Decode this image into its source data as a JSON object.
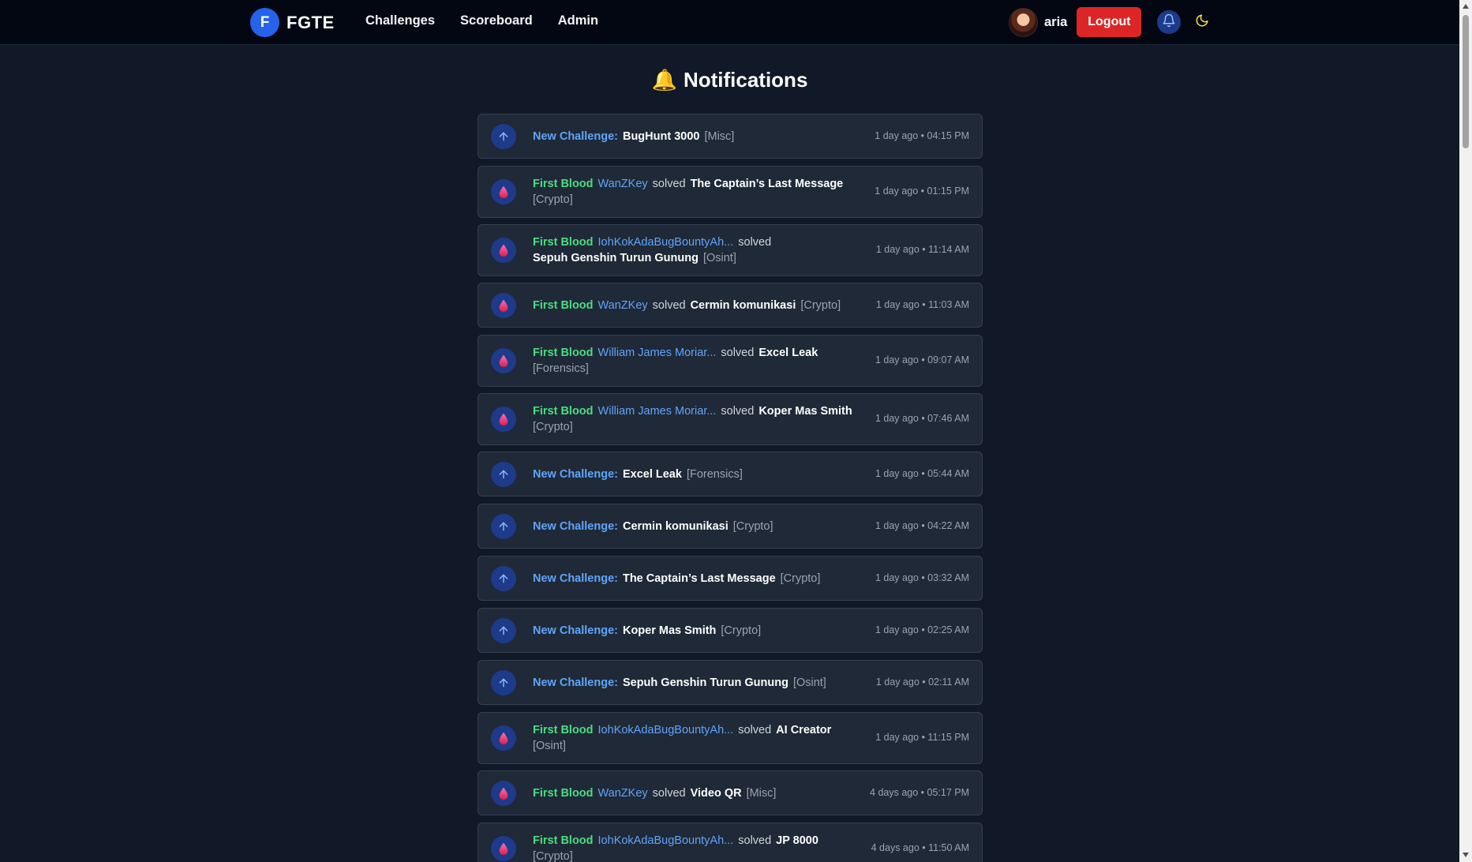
{
  "brand": {
    "logo_letter": "F",
    "name": "FGTE"
  },
  "nav": {
    "items": [
      "Challenges",
      "Scoreboard",
      "Admin"
    ]
  },
  "user": {
    "name": "aria",
    "logout_label": "Logout"
  },
  "colors": {
    "background": "#111827",
    "navbar": "#030712",
    "card": "#1f2937",
    "accent_blue": "#60a5fa",
    "first_blood_green": "#4ade80",
    "logout_red": "#dc2626"
  },
  "icons": {
    "bell": "bell-icon",
    "moon": "moon-icon",
    "new_challenge": "arrow-up-icon",
    "first_blood": "blood-drop-icon"
  },
  "page": {
    "title_icon": "🔔",
    "title": "Notifications"
  },
  "notifications": [
    {
      "type": "new",
      "label": "New Challenge:",
      "challenge": "BugHunt 3000",
      "category": "[Misc]",
      "time": "1 day ago • 04:15 PM"
    },
    {
      "type": "blood",
      "label": "First Blood",
      "user": "WanZKey",
      "verb": "solved",
      "challenge": "The Captain’s Last Message",
      "category": "[Crypto]",
      "time": "1 day ago • 01:15 PM"
    },
    {
      "type": "blood",
      "label": "First Blood",
      "user": "IohKokAdaBugBountyAh...",
      "verb": "solved",
      "challenge": "Sepuh Genshin Turun Gunung",
      "category": "[Osint]",
      "time": "1 day ago • 11:14 AM"
    },
    {
      "type": "blood",
      "label": "First Blood",
      "user": "WanZKey",
      "verb": "solved",
      "challenge": "Cermin komunikasi",
      "category": "[Crypto]",
      "time": "1 day ago • 11:03 AM"
    },
    {
      "type": "blood",
      "label": "First Blood",
      "user": "William James Moriar...",
      "verb": "solved",
      "challenge": "Excel Leak",
      "category": "[Forensics]",
      "time": "1 day ago • 09:07 AM"
    },
    {
      "type": "blood",
      "label": "First Blood",
      "user": "William James Moriar...",
      "verb": "solved",
      "challenge": "Koper Mas Smith",
      "category": "[Crypto]",
      "time": "1 day ago • 07:46 AM"
    },
    {
      "type": "new",
      "label": "New Challenge:",
      "challenge": "Excel Leak",
      "category": "[Forensics]",
      "time": "1 day ago • 05:44 AM"
    },
    {
      "type": "new",
      "label": "New Challenge:",
      "challenge": "Cermin komunikasi",
      "category": "[Crypto]",
      "time": "1 day ago • 04:22 AM"
    },
    {
      "type": "new",
      "label": "New Challenge:",
      "challenge": "The Captain’s Last Message",
      "category": "[Crypto]",
      "time": "1 day ago • 03:32 AM"
    },
    {
      "type": "new",
      "label": "New Challenge:",
      "challenge": "Koper Mas Smith",
      "category": "[Crypto]",
      "time": "1 day ago • 02:25 AM"
    },
    {
      "type": "new",
      "label": "New Challenge:",
      "challenge": "Sepuh Genshin Turun Gunung",
      "category": "[Osint]",
      "time": "1 day ago • 02:11 AM"
    },
    {
      "type": "blood",
      "label": "First Blood",
      "user": "IohKokAdaBugBountyAh...",
      "verb": "solved",
      "challenge": "AI Creator",
      "category": "[Osint]",
      "time": "1 day ago • 11:15 PM"
    },
    {
      "type": "blood",
      "label": "First Blood",
      "user": "WanZKey",
      "verb": "solved",
      "challenge": "Video QR",
      "category": "[Misc]",
      "time": "4 days ago • 05:17 PM"
    },
    {
      "type": "blood",
      "label": "First Blood",
      "user": "IohKokAdaBugBountyAh...",
      "verb": "solved",
      "challenge": "JP 8000",
      "category": "[Crypto]",
      "time": "4 days ago • 11:50 AM"
    }
  ]
}
